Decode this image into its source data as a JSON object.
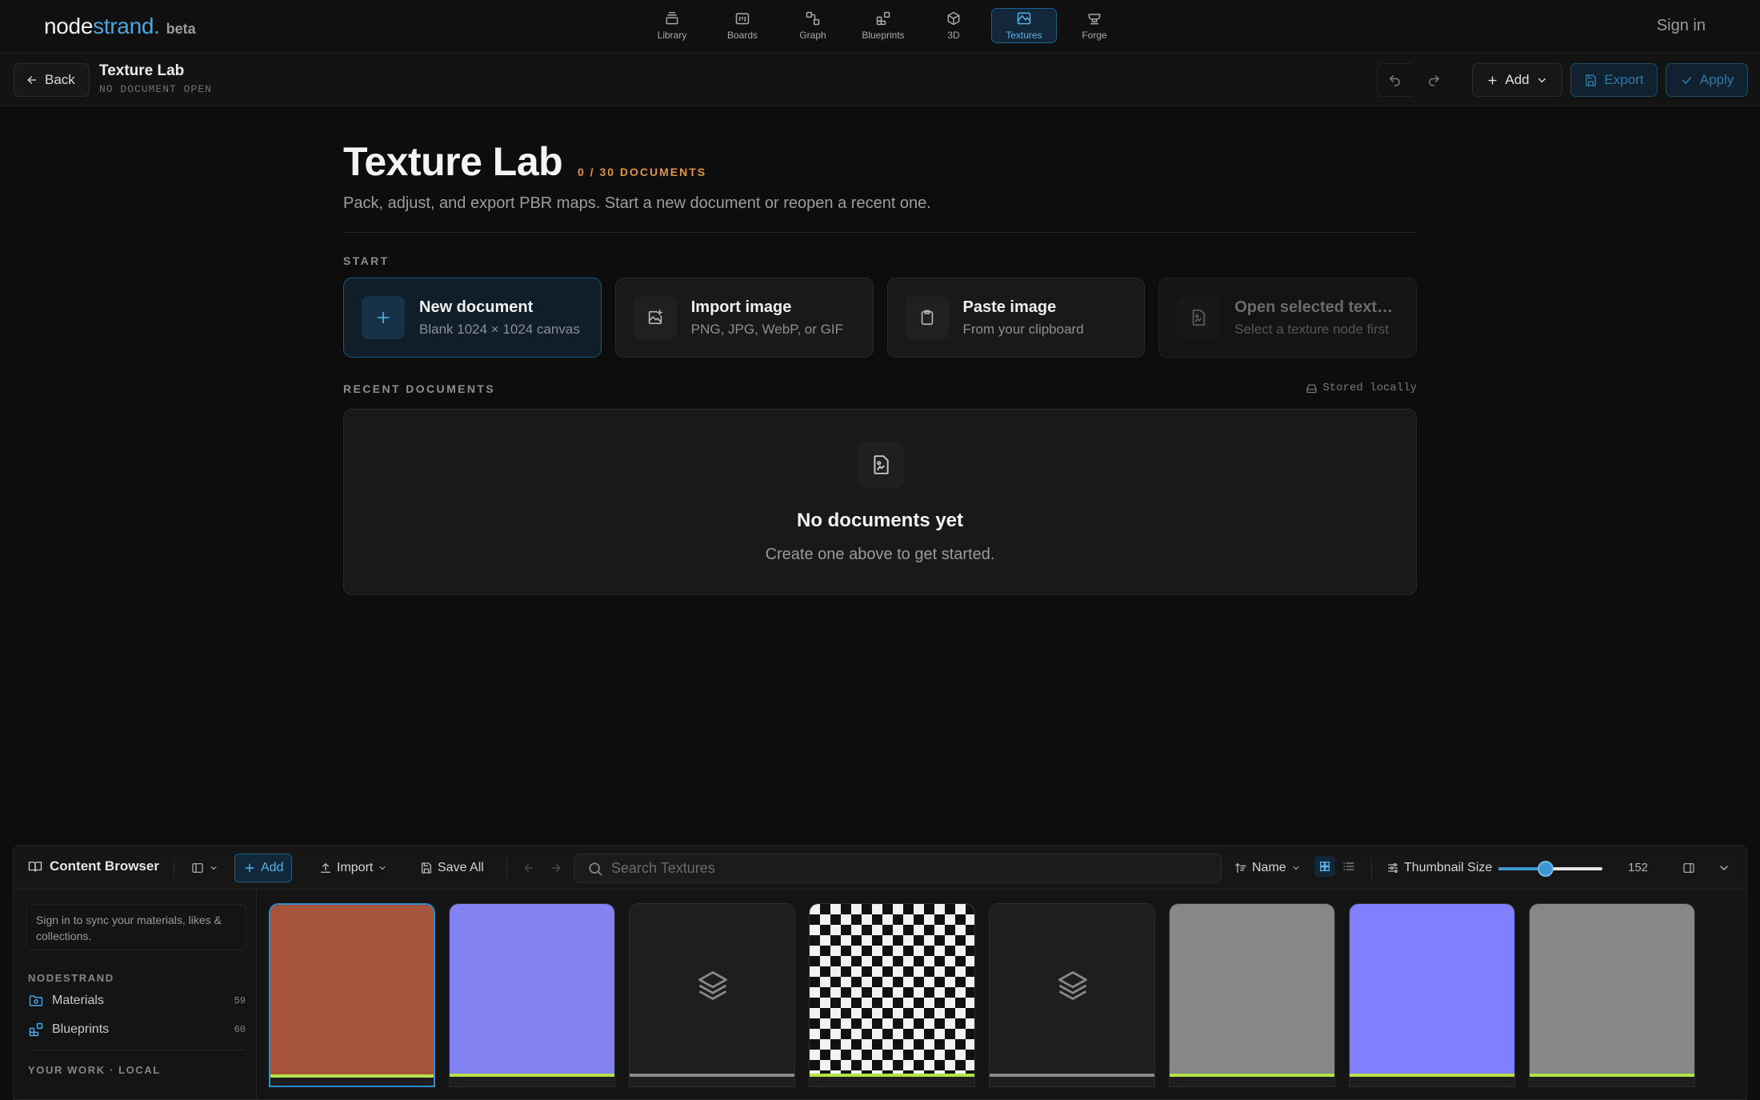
{
  "app": {
    "logo_main": "node",
    "logo_accent": "strand.",
    "logo_beta": "beta",
    "sign_in": "Sign in"
  },
  "nav": [
    {
      "label": "Library",
      "icon": "library-icon",
      "active": false
    },
    {
      "label": "Boards",
      "icon": "boards-icon",
      "active": false
    },
    {
      "label": "Graph",
      "icon": "graph-icon",
      "active": false
    },
    {
      "label": "Blueprints",
      "icon": "blueprints-icon",
      "active": false
    },
    {
      "label": "3D",
      "icon": "cube-icon",
      "active": true
    },
    {
      "label": "Textures",
      "icon": "textures-icon",
      "active": true
    },
    {
      "label": "Forge",
      "icon": "anvil-icon",
      "active": false
    }
  ],
  "subbar": {
    "back": "Back",
    "title": "Texture Lab",
    "subtitle": "NO DOCUMENT OPEN",
    "add": "Add",
    "export": "Export",
    "apply": "Apply"
  },
  "hero": {
    "title": "Texture Lab",
    "count": "0 / 30 DOCUMENTS",
    "description": "Pack, adjust, and export PBR maps. Start a new document or reopen a recent one."
  },
  "start": {
    "label": "START",
    "cards": [
      {
        "title": "New document",
        "sub": "Blank 1024 × 1024 canvas"
      },
      {
        "title": "Import image",
        "sub": "PNG, JPG, WebP, or GIF"
      },
      {
        "title": "Paste image",
        "sub": "From your clipboard"
      },
      {
        "title": "Open selected text…",
        "sub": "Select a texture node first"
      }
    ]
  },
  "recent": {
    "label": "RECENT DOCUMENTS",
    "stored": "Stored locally",
    "empty_title": "No documents yet",
    "empty_sub": "Create one above to get started."
  },
  "browser": {
    "title": "Content Browser",
    "add": "Add",
    "import": "Import",
    "save_all": "Save All",
    "search_placeholder": "Search Textures",
    "sort": "Name",
    "thumb_label": "Thumbnail Size",
    "thumb_value": "152",
    "thumb_fraction": 0.45,
    "sync_note": "Sign in to sync your materials, likes & collections.",
    "section_nodestrand": "NODESTRAND",
    "materials": "Materials",
    "materials_count": "59",
    "blueprints": "Blueprints",
    "blueprints_count": "60",
    "section_local": "YOUR WORK · LOCAL",
    "tiles": [
      {
        "color": "#a5533a",
        "bar": "#b5e048",
        "kind": "swatch"
      },
      {
        "color": "#8282f2",
        "bar": "#b5e048",
        "kind": "swatch"
      },
      {
        "color": "#1e1e20",
        "bar": "#8a8a8e",
        "kind": "layers"
      },
      {
        "color": "checker",
        "bar": "#b5e048",
        "kind": "checker"
      },
      {
        "color": "#1e1e20",
        "bar": "#8a8a8e",
        "kind": "layers"
      },
      {
        "color": "#878787",
        "bar": "#b5e048",
        "kind": "swatch"
      },
      {
        "color": "#8080ff",
        "bar": "#b5e048",
        "kind": "swatch"
      },
      {
        "color": "#878787",
        "bar": "#b5e048",
        "kind": "swatch"
      }
    ]
  },
  "colors": {
    "accent": "#4aa6e0",
    "count_orange": "#e09540"
  }
}
